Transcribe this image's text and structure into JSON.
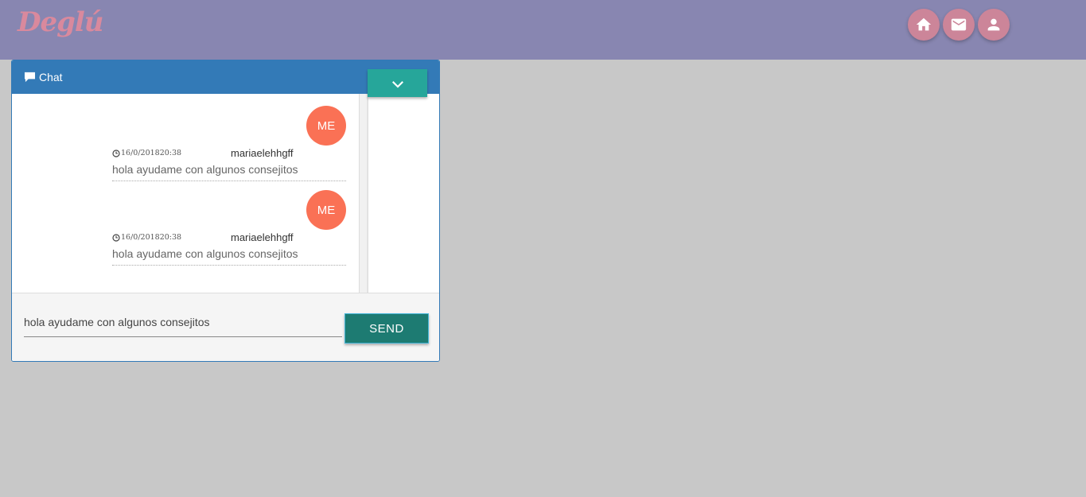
{
  "app": {
    "logo_text": "Deglú",
    "colors": {
      "topbar": "#8886b1",
      "logo": "#d9899d",
      "nav_button": "#cc8599",
      "chat_header": "#337ab7",
      "toggle_button": "#26a69a",
      "send_button": "#1d7b72",
      "avatar": "#fa7155"
    }
  },
  "nav": {
    "buttons": [
      {
        "name": "home",
        "icon": "home-icon"
      },
      {
        "name": "mail",
        "icon": "mail-icon"
      },
      {
        "name": "profile",
        "icon": "user-icon"
      }
    ]
  },
  "chat": {
    "title": "Chat",
    "title_icon": "comment-icon",
    "toggle_icon": "chevron-down-icon",
    "messages": [
      {
        "avatar": "ME",
        "time": "16/0/201820:38",
        "user": "mariaelehhgff",
        "text": "hola ayudame con algunos consejitos"
      },
      {
        "avatar": "ME",
        "time": "16/0/201820:38",
        "user": "mariaelehhgff",
        "text": "hola ayudame con algunos consejitos"
      }
    ],
    "input_value": "hola ayudame con algunos consejitos",
    "send_label": "SEND"
  }
}
